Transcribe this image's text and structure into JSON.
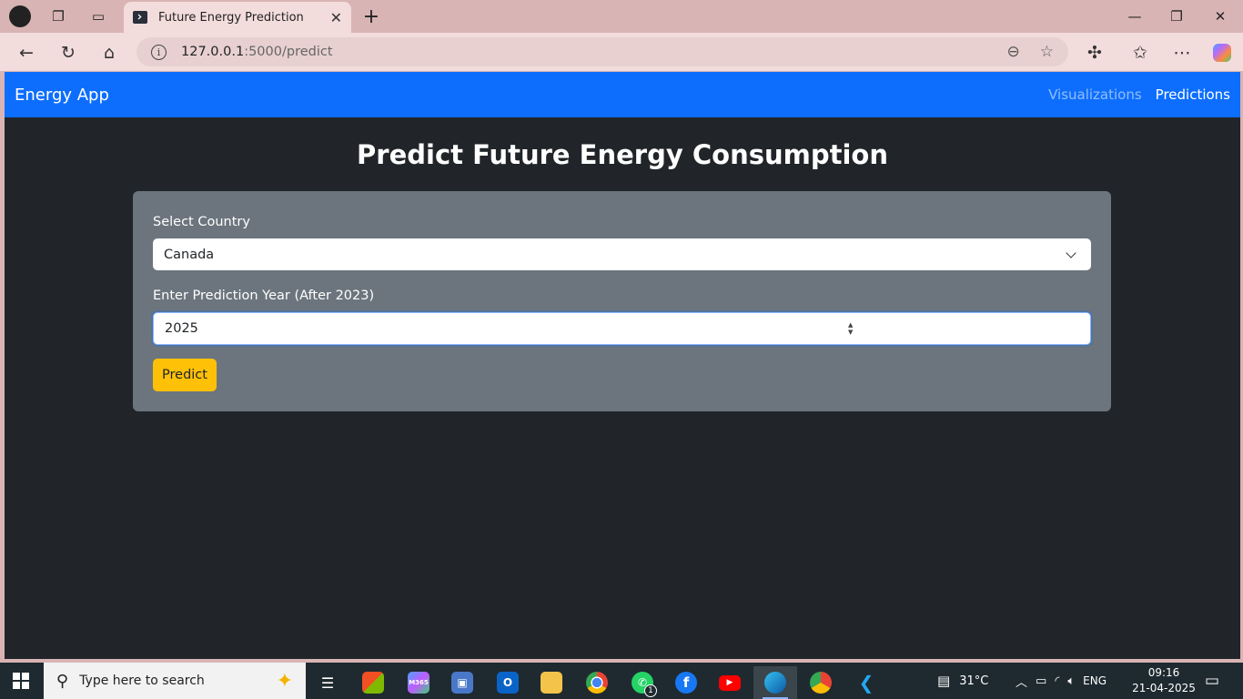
{
  "browser": {
    "tab_title": "Future Energy Prediction",
    "url_host": "127.0.0.1",
    "url_path": ":5000/predict"
  },
  "app": {
    "brand": "Energy App",
    "nav": [
      {
        "label": "Visualizations",
        "active": false
      },
      {
        "label": "Predictions",
        "active": true
      }
    ]
  },
  "page": {
    "heading": "Predict Future Energy Consumption",
    "country_label": "Select Country",
    "country_value": "Canada",
    "year_label": "Enter Prediction Year (After 2023)",
    "year_value": "2025",
    "submit_label": "Predict"
  },
  "taskbar": {
    "search_placeholder": "Type here to search",
    "weather": "31°C",
    "language": "ENG",
    "time": "09:16",
    "date": "21-04-2025",
    "whatsapp_badge": "1",
    "m365_label": "M365"
  },
  "colors": {
    "navbar": "#0d6efd",
    "page_bg": "#212529",
    "card_bg": "#6c757d",
    "button": "#ffc107",
    "browser_chrome": "#d9b4b4"
  }
}
